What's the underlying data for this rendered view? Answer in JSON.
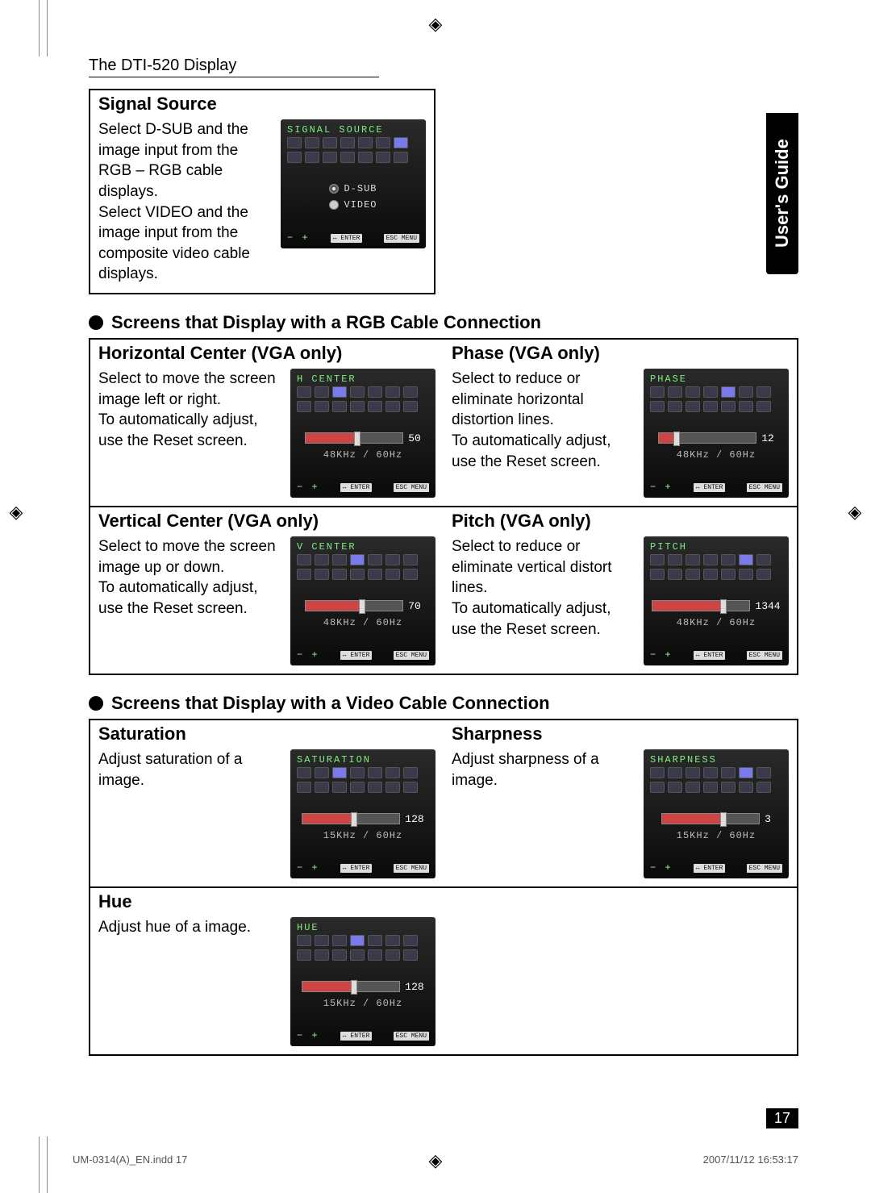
{
  "header": "The DTI-520 Display",
  "side_tab": "User's Guide",
  "page_number": "17",
  "footer_left": "UM-0314(A)_EN.indd   17",
  "footer_right": "2007/11/12   16:53:17",
  "section_rgb": "Screens that Display with a RGB Cable Connection",
  "section_video": "Screens that Display with a Video Cable Connection",
  "signal_source": {
    "title": "Signal Source",
    "desc": "Select D-SUB and the image input from the RGB – RGB cable displays.\nSelect VIDEO and the image input from the composite video cable displays.",
    "osd_title": "SIGNAL SOURCE",
    "opt1": "D-SUB",
    "opt2": "VIDEO"
  },
  "hcenter": {
    "title": "Horizontal Center (VGA only)",
    "desc": "Select to move the screen image left or right.\nTo automatically adjust, use the Reset screen.",
    "osd_title": "H CENTER",
    "value": "50",
    "freq": "48KHz / 60Hz"
  },
  "phase": {
    "title": "Phase (VGA only)",
    "desc": "Select to reduce or eliminate horizontal distortion lines.\nTo automatically adjust, use the Reset screen.",
    "osd_title": "PHASE",
    "value": "12",
    "freq": "48KHz / 60Hz"
  },
  "vcenter": {
    "title": "Vertical Center (VGA only)",
    "desc": "Select to move the screen image up or down.\nTo automatically adjust, use the Reset screen.",
    "osd_title": "V CENTER",
    "value": "70",
    "freq": "48KHz / 60Hz"
  },
  "pitch": {
    "title": "Pitch (VGA only)",
    "desc": "Select to reduce or eliminate vertical distort lines.\nTo automatically adjust, use the Reset screen.",
    "osd_title": "PITCH",
    "value": "1344",
    "freq": "48KHz / 60Hz"
  },
  "saturation": {
    "title": "Saturation",
    "desc": "Adjust saturation of a image.",
    "osd_title": "SATURATION",
    "value": "128",
    "freq": "15KHz / 60Hz"
  },
  "sharpness": {
    "title": "Sharpness",
    "desc": "Adjust sharpness of a image.",
    "osd_title": "SHARPNESS",
    "value": "3",
    "freq": "15KHz / 60Hz"
  },
  "hue": {
    "title": "Hue",
    "desc": "Adjust hue of a image.",
    "osd_title": "HUE",
    "value": "128",
    "freq": "15KHz / 60Hz"
  },
  "osd_common": {
    "minus_plus": "− +",
    "enter": "↔ ENTER",
    "esc": "ESC MENU"
  }
}
